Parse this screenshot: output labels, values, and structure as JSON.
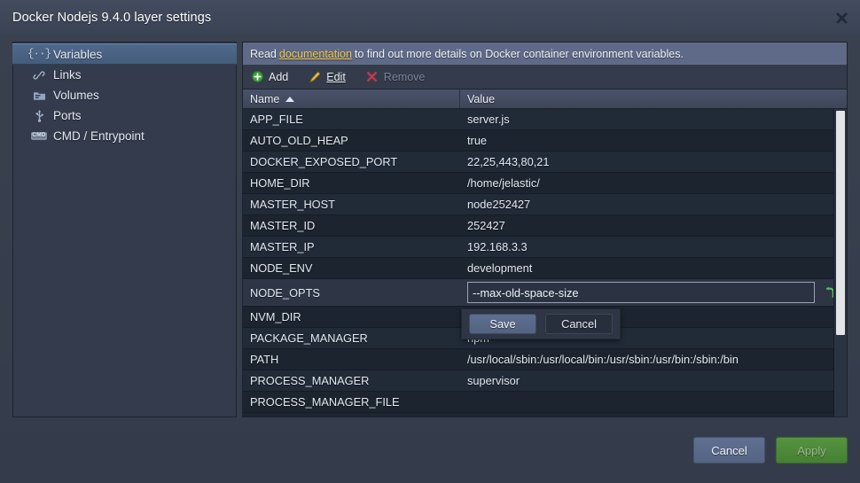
{
  "window": {
    "title": "Docker Nodejs 9.4.0 layer settings",
    "close_icon": "close-icon"
  },
  "sidebar": {
    "items": [
      {
        "label": "Variables",
        "icon": "braces-icon",
        "selected": true
      },
      {
        "label": "Links",
        "icon": "link-icon",
        "selected": false
      },
      {
        "label": "Volumes",
        "icon": "folder-icon",
        "selected": false
      },
      {
        "label": "Ports",
        "icon": "usb-icon",
        "selected": false
      },
      {
        "label": "CMD / Entrypoint",
        "icon": "cmd-icon",
        "selected": false
      }
    ]
  },
  "banner": {
    "prefix": "Read",
    "link": "documentation",
    "suffix": "to find out more details on Docker container environment variables."
  },
  "toolbar": {
    "add_label": "Add",
    "edit_label": "Edit",
    "remove_label": "Remove",
    "add_icon": "plus-circle-icon",
    "edit_icon": "pencil-icon",
    "remove_icon": "remove-x-icon"
  },
  "table": {
    "columns": {
      "name": "Name",
      "value": "Value"
    },
    "sort": {
      "column": "Name",
      "direction": "asc",
      "icon": "sort-ascending-icon"
    },
    "rows": [
      {
        "name": "APP_FILE",
        "value": "server.js"
      },
      {
        "name": "AUTO_OLD_HEAP",
        "value": "true"
      },
      {
        "name": "DOCKER_EXPOSED_PORT",
        "value": "22,25,443,80,21"
      },
      {
        "name": "HOME_DIR",
        "value": "/home/jelastic/"
      },
      {
        "name": "MASTER_HOST",
        "value": "node252427"
      },
      {
        "name": "MASTER_ID",
        "value": "252427"
      },
      {
        "name": "MASTER_IP",
        "value": "192.168.3.3"
      },
      {
        "name": "NODE_ENV",
        "value": "development"
      },
      {
        "name": "NODE_OPTS",
        "value": "--max-old-space-size",
        "editing": true
      },
      {
        "name": "NVM_DIR",
        "value": ""
      },
      {
        "name": "PACKAGE_MANAGER",
        "value": "npm"
      },
      {
        "name": "PATH",
        "value": "/usr/local/sbin:/usr/local/bin:/usr/sbin:/usr/bin:/sbin:/bin"
      },
      {
        "name": "PROCESS_MANAGER",
        "value": "supervisor"
      },
      {
        "name": "PROCESS_MANAGER_FILE",
        "value": ""
      }
    ]
  },
  "editor": {
    "field_value": "--max-old-space-size",
    "revert_icon": "revert-icon",
    "save_label": "Save",
    "cancel_label": "Cancel"
  },
  "footer": {
    "cancel_label": "Cancel",
    "apply_label": "Apply"
  },
  "colors": {
    "accent_link": "#f5c842",
    "apply_green": "#4d8a39",
    "cancel_blue": "#5b6a8a",
    "selected_row": "#4a6281"
  }
}
